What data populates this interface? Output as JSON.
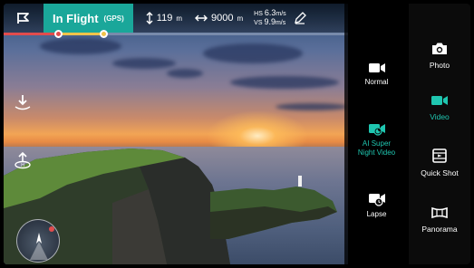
{
  "status": {
    "flight_mode": "In Flight",
    "gps": "(GPS)",
    "altitude_value": "119",
    "altitude_unit": "m",
    "distance_value": "9000",
    "distance_unit": "m",
    "hs_label": "HS",
    "hs_value": "6.3",
    "hs_unit": "m/s",
    "vs_label": "VS",
    "vs_value": "9.9",
    "vs_unit": "m/s"
  },
  "flight_progress": {
    "red_fraction": 0.16,
    "yellow_end_fraction": 0.29
  },
  "modes": [
    {
      "label": "Normal",
      "icon": "video-camera-icon"
    },
    {
      "label": "AI Super Night Video",
      "line1": "AI Super",
      "line2": "Night Video",
      "icon": "night-video-icon",
      "active": true
    },
    {
      "label": "Lapse",
      "icon": "timelapse-icon"
    }
  ],
  "camera_modes": [
    {
      "label": "Photo",
      "icon": "camera-icon"
    },
    {
      "label": "Video",
      "icon": "video-icon",
      "active": true
    },
    {
      "label": "Quick Shot",
      "icon": "quickshot-icon"
    },
    {
      "label": "Panorama",
      "icon": "panorama-icon"
    }
  ],
  "colors": {
    "accent": "#1fc6b0",
    "status_bar": "#1aa79a",
    "progress_red": "#e24c4c",
    "progress_yellow": "#f0c34a"
  }
}
